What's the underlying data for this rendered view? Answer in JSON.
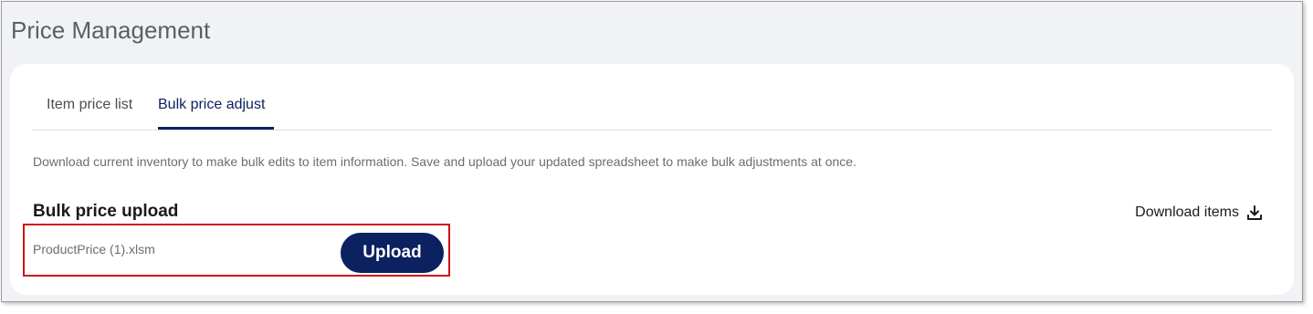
{
  "page": {
    "title": "Price Management"
  },
  "tabs": [
    {
      "label": "Item price list",
      "active": false
    },
    {
      "label": "Bulk price adjust",
      "active": true
    }
  ],
  "description": "Download current inventory to make bulk edits to item information. Save and upload your updated spreadsheet to make bulk adjustments at once.",
  "bulk_upload": {
    "title": "Bulk price upload",
    "filename": "ProductPrice (1).xlsm",
    "upload_label": "Upload"
  },
  "download": {
    "label": "Download items",
    "icon": "download-icon"
  },
  "colors": {
    "primary": "#0b2160",
    "highlight": "#d0121b",
    "background": "#f1f2f6"
  }
}
